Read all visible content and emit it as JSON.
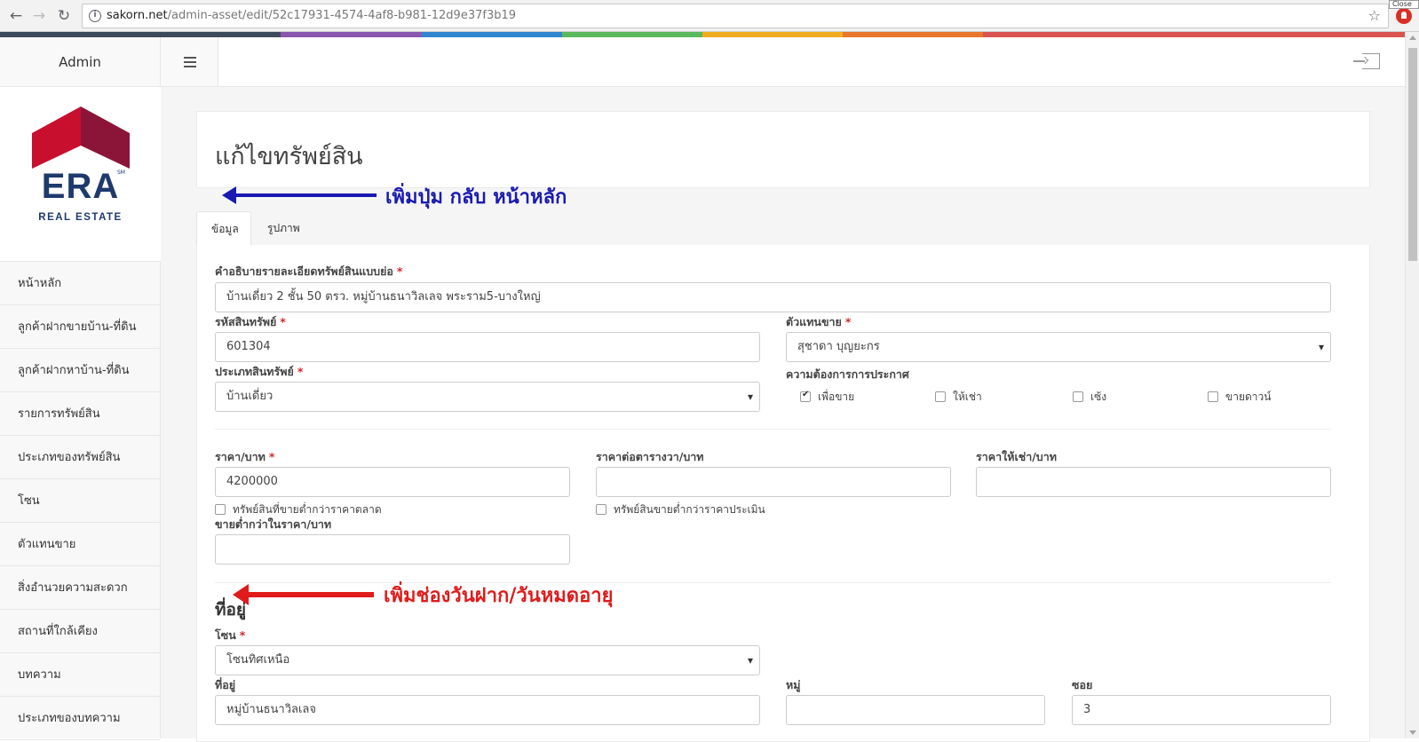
{
  "browser": {
    "url_host": "sakorn.net",
    "url_path": "/admin-asset/edit/52c17931-4574-4af8-b981-12d9e37f3b19",
    "close_tooltip": "Close"
  },
  "rainbow_colors": [
    "#3d4a5c",
    "#3d4a5c",
    "#8a56b0",
    "#2e86d1",
    "#5cb85c",
    "#f0ad1f",
    "#e8762b",
    "#d9534f",
    "#d9534f",
    "#d9534f"
  ],
  "header": {
    "brand": "Admin"
  },
  "logo": {
    "text": "ERA",
    "subtext": "REAL ESTATE",
    "sm": "SM",
    "colors": {
      "roof_left": "#c8102e",
      "roof_right": "#8b1538",
      "text": "#1e3a6d"
    }
  },
  "sidebar": {
    "items": [
      {
        "label": "หน้าหลัก"
      },
      {
        "label": "ลูกค้าฝากขายบ้าน-ที่ดิน"
      },
      {
        "label": "ลูกค้าฝากหาบ้าน-ที่ดิน"
      },
      {
        "label": "รายการทรัพย์สิน"
      },
      {
        "label": "ประเภทของทรัพย์สิน"
      },
      {
        "label": "โซน"
      },
      {
        "label": "ตัวแทนขาย"
      },
      {
        "label": "สิ่งอำนวยความสะดวก"
      },
      {
        "label": "สถานที่ใกล้เคียง"
      },
      {
        "label": "บทความ"
      },
      {
        "label": "ประเภทของบทความ"
      }
    ]
  },
  "page": {
    "title": "แก้ไขทรัพย์สิน"
  },
  "tabs": [
    {
      "label": "ข้อมูล",
      "active": true
    },
    {
      "label": "รูปภาพ",
      "active": false
    }
  ],
  "form": {
    "short_desc_label": "คำอธิบายรายละเอียดทรัพย์สินแบบย่อ",
    "short_desc_value": "บ้านเดี่ยว 2 ชั้น 50 ตรว. หมู่บ้านธนาวิลเลจ พระราม5-บางใหญ่",
    "code_label": "รหัสสินทรัพย์",
    "code_value": "601304",
    "agent_label": "ตัวแทนขาย",
    "agent_value": "สุชาดา บุญยะกร",
    "type_label": "ประเภทสินทรัพย์",
    "type_value": "บ้านเดี่ยว",
    "announce_label": "ความต้องการการประกาศ",
    "announce_options": [
      {
        "label": "เพื่อขาย",
        "checked": true
      },
      {
        "label": "ให้เช่า",
        "checked": false
      },
      {
        "label": "เซ้ง",
        "checked": false
      },
      {
        "label": "ขายดาวน์",
        "checked": false
      }
    ],
    "price_label": "ราคา/บาท",
    "price_value": "4200000",
    "price_sqw_label": "ราคาต่อตารางวา/บาท",
    "price_sqw_value": "",
    "rent_label": "ราคาให้เช่า/บาท",
    "rent_value": "",
    "below_market_label": "ทรัพย์สินที่ขายต่ำกว่าราคาตลาด",
    "below_appraisal_label": "ทรัพย์สินขายต่ำกว่าราคาประเมิน",
    "below_price_label": "ขายต่ำกว่าในราคา/บาท",
    "below_price_value": "",
    "location_title": "ที่อยู่",
    "zone_label": "โซน",
    "zone_value": "โซนทิศเหนือ",
    "address_label": "ที่อยู่",
    "address_value": "หมู่บ้านธนาวิลเลจ",
    "moo_label": "หมู่",
    "moo_value": "",
    "soi_label": "ซอย",
    "soi_value": "3",
    "required_mark": "*"
  },
  "annotations": {
    "blue_text": "เพิ่มปุ่ม กลับ หน้าหลัก",
    "red_text": "เพิ่มช่องวันฝาก/วันหมดอายุ",
    "blue_color": "#1a1ab3",
    "red_color": "#e01b1b"
  }
}
